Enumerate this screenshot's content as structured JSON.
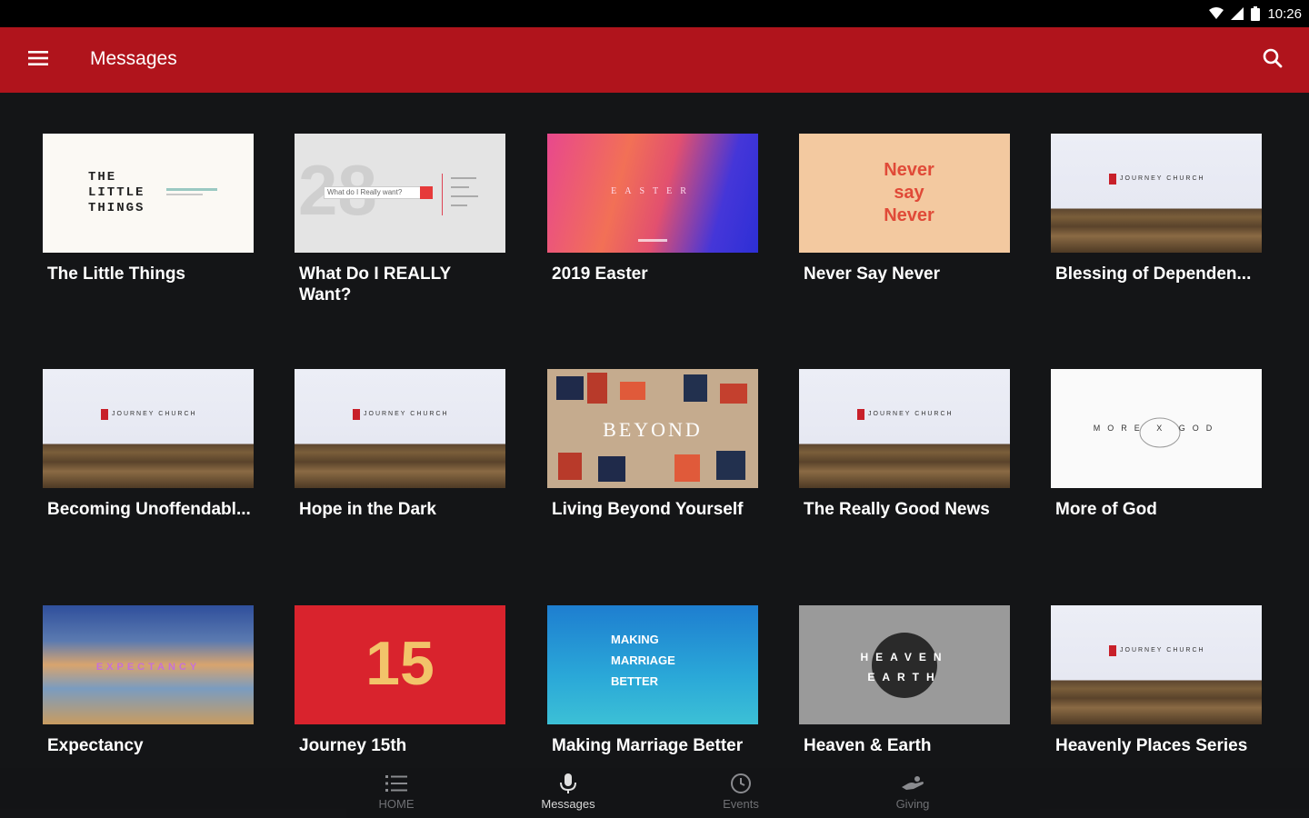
{
  "status_bar": {
    "time": "10:26"
  },
  "app_bar": {
    "title": "Messages"
  },
  "messages": [
    {
      "title": "The Little Things",
      "thumb_text": "THE LITTLE THINGS"
    },
    {
      "title": "What Do I REALLY Want?",
      "thumb_text": "What do I Really want?"
    },
    {
      "title": "2019 Easter",
      "thumb_text": "EASTER"
    },
    {
      "title": "Never Say Never",
      "thumb_text": "Never say Never"
    },
    {
      "title": "Blessing of Dependen...",
      "thumb_text": "JOURNEY CHURCH"
    },
    {
      "title": "Becoming Unoffendabl...",
      "thumb_text": "JOURNEY CHURCH"
    },
    {
      "title": "Hope in the Dark",
      "thumb_text": "JOURNEY CHURCH"
    },
    {
      "title": "Living Beyond Yourself",
      "thumb_text": "BEYOND"
    },
    {
      "title": "The Really Good News",
      "thumb_text": "JOURNEY CHURCH"
    },
    {
      "title": "More of God",
      "thumb_text": "MORE X GOD"
    },
    {
      "title": "Expectancy",
      "thumb_text": "EXPECTANCY"
    },
    {
      "title": "Journey 15th",
      "thumb_text": "15"
    },
    {
      "title": "Making Marriage Better",
      "thumb_text": "MAKING MARRIAGE BETTER"
    },
    {
      "title": "Heaven & Earth",
      "thumb_text": "HEAVEN EARTH"
    },
    {
      "title": "Heavenly Places Series",
      "thumb_text": "JOURNEY CHURCH"
    }
  ],
  "bottom_nav": {
    "items": [
      {
        "label": "HOME",
        "icon": "list-icon",
        "active": false
      },
      {
        "label": "Messages",
        "icon": "microphone-icon",
        "active": true
      },
      {
        "label": "Events",
        "icon": "clock-icon",
        "active": false
      },
      {
        "label": "Giving",
        "icon": "giving-hand-icon",
        "active": false
      }
    ]
  },
  "colors": {
    "app_bar": "#b0141c",
    "background": "#141517",
    "status_bar": "#000000"
  }
}
